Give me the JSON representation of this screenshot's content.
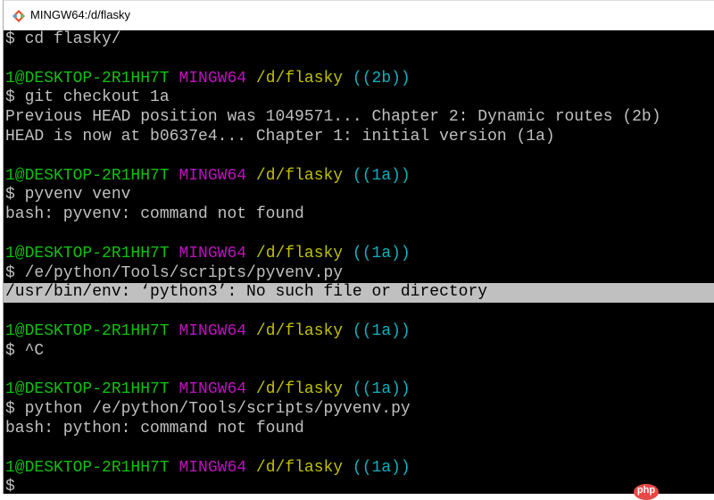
{
  "window": {
    "title": "MINGW64:/d/flasky"
  },
  "prompt": {
    "user_host": "1@DESKTOP-2R1HH7T",
    "system": "MINGW64",
    "path": "/d/flasky"
  },
  "lines": [
    {
      "type": "text",
      "text": "$ cd flasky/"
    },
    {
      "type": "text",
      "text": ""
    },
    {
      "type": "prompt",
      "branch": "((2b))"
    },
    {
      "type": "text",
      "text": "$ git checkout 1a"
    },
    {
      "type": "text",
      "text": "Previous HEAD position was 1049571... Chapter 2: Dynamic routes (2b)"
    },
    {
      "type": "text",
      "text": "HEAD is now at b0637e4... Chapter 1: initial version (1a)"
    },
    {
      "type": "text",
      "text": ""
    },
    {
      "type": "prompt",
      "branch": "((1a))"
    },
    {
      "type": "text",
      "text": "$ pyvenv venv"
    },
    {
      "type": "text",
      "text": "bash: pyvenv: command not found"
    },
    {
      "type": "text",
      "text": ""
    },
    {
      "type": "prompt",
      "branch": "((1a))"
    },
    {
      "type": "text",
      "text": "$ /e/python/Tools/scripts/pyvenv.py"
    },
    {
      "type": "text",
      "text": "/usr/bin/env: ‘python3’: No such file or directory",
      "highlight": true
    },
    {
      "type": "text",
      "text": ""
    },
    {
      "type": "prompt",
      "branch": "((1a))"
    },
    {
      "type": "text",
      "text": "$ ^C"
    },
    {
      "type": "text",
      "text": ""
    },
    {
      "type": "prompt",
      "branch": "((1a))"
    },
    {
      "type": "text",
      "text": "$ python /e/python/Tools/scripts/pyvenv.py"
    },
    {
      "type": "text",
      "text": "bash: python: command not found"
    },
    {
      "type": "text",
      "text": ""
    },
    {
      "type": "prompt",
      "branch": "((1a))"
    },
    {
      "type": "text",
      "text": "$"
    }
  ],
  "watermark": "php"
}
